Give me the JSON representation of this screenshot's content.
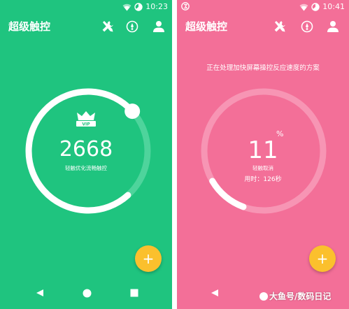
{
  "colors": {
    "left_bg": "#1fc47f",
    "right_bg": "#f36f98",
    "fab": "#fbc02d",
    "ring_track_left": "#4ed49c",
    "ring_track_right": "#f795b4"
  },
  "icons": {
    "status_left_right_phone": "app-notification-icon",
    "wifi": "wifi-icon",
    "battery": "battery-icon",
    "appbar_tools": "wrench-screwdriver-icon",
    "appbar_speed": "speed-gauge-icon",
    "appbar_user": "person-icon",
    "crown": "crown-icon",
    "fab": "plus-icon",
    "nav_back": "back-triangle-icon",
    "nav_home": "home-circle-icon",
    "nav_recent": "recents-square-icon"
  },
  "left": {
    "status": {
      "time": "10:23"
    },
    "appbar": {
      "title": "超级触控"
    },
    "crown_badge": "VIP",
    "ring": {
      "progress": 0.75
    },
    "score": "2668",
    "caption": "轻触优化流畅触控",
    "fab_symbol": "+"
  },
  "right": {
    "status": {
      "time": "10:41"
    },
    "appbar": {
      "title": "超级触控"
    },
    "subtitle": "正在处理加快屏幕操控反应速度的方案",
    "ring": {
      "progress": 0.11
    },
    "percent_value": "11",
    "percent_sign": "%",
    "caption": "轻触取消",
    "elapsed": "用时：126秒",
    "fab_symbol": "+"
  },
  "watermark": "大鱼号/数码日记"
}
